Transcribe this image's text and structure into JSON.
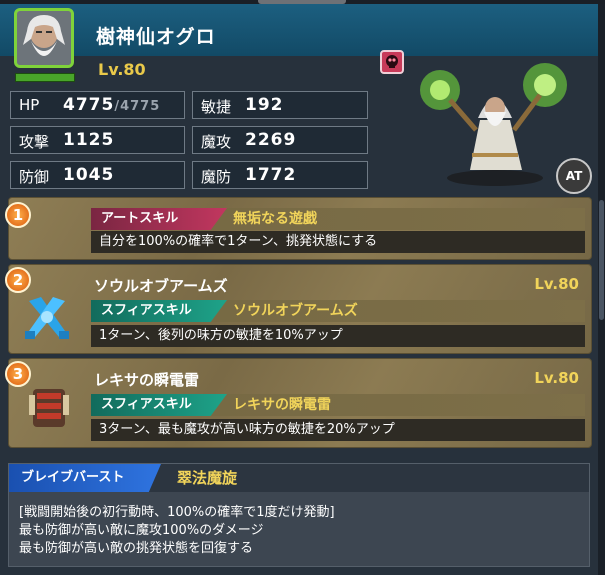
{
  "character": {
    "name": "樹神仙オグロ",
    "level": "Lv.80"
  },
  "stats": {
    "hp_label": "HP",
    "hp_value": "4775",
    "hp_max": "/4775",
    "atk_label": "攻撃",
    "atk_value": "1125",
    "def_label": "防御",
    "def_value": "1045",
    "agi_label": "敏捷",
    "agi_value": "192",
    "matk_label": "魔攻",
    "matk_value": "2269",
    "mdef_label": "魔防",
    "mdef_value": "1772"
  },
  "at_button": "AT",
  "skills": [
    {
      "number": "1",
      "type": "アートスキル",
      "name": "無垢なる遊戯",
      "description": "自分を100%の確率で1ターン、挑発状態にする"
    },
    {
      "number": "2",
      "title": "ソウルオブアームズ",
      "level": "Lv.80",
      "type": "スフィアスキル",
      "name": "ソウルオブアームズ",
      "description": "1ターン、後列の味方の敏捷を10%アップ"
    },
    {
      "number": "3",
      "title": "レキサの瞬電雷",
      "level": "Lv.80",
      "type": "スフィアスキル",
      "name": "レキサの瞬電雷",
      "description": "3ターン、最も魔攻が高い味方の敏捷を20%アップ"
    }
  ],
  "brave_burst": {
    "type": "ブレイブバースト",
    "name": "翠法魔旋",
    "lines": [
      "[戦闘開始後の初行動時、100%の確率で1度だけ発動]",
      "最も防御が高い敵に魔攻100%のダメージ",
      "最も防御が高い敵の挑発状態を回復する"
    ]
  },
  "colors": {
    "accent_gold": "#f1d45a",
    "art_skill": "#c2375f",
    "sphere_skill": "#1ea389",
    "brave_burst": "#2f74e0",
    "hp_bar": "#49a52a"
  },
  "icons": {
    "element": "dark-element-icon",
    "skill2": "sphere-crossed-swords-icon",
    "skill3": "sphere-armor-icon"
  }
}
